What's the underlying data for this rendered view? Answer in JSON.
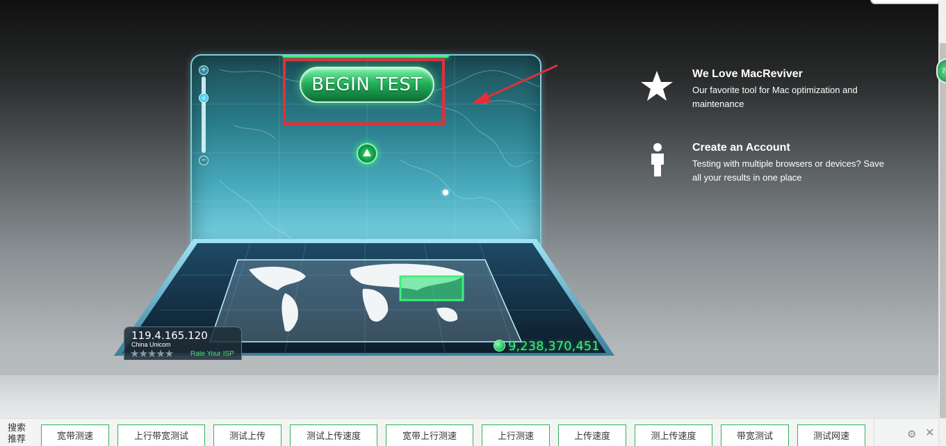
{
  "test": {
    "begin_label": "BEGIN TEST",
    "zoom_in": "+",
    "zoom_out": "−"
  },
  "connection": {
    "ip": "119.4.165.120",
    "isp": "China Unicom",
    "stars": "★★★★★",
    "rate_label": "Rate Your ISP",
    "test_count": "9,238,370,451"
  },
  "promos": [
    {
      "icon": "star-icon",
      "title": "We Love MacReviver",
      "description": "Our favorite tool for Mac optimization and maintenance"
    },
    {
      "icon": "person-icon",
      "title": "Create an Account",
      "description": "Testing with multiple browsers or devices? Save all your results in one place"
    }
  ],
  "search_bar": {
    "label": "搜索推荐",
    "chips": [
      "宽带测速",
      "上行带宽测试",
      "测试上传",
      "测试上传速度",
      "宽带上行测速",
      "上行测速",
      "上传速度",
      "测上传速度",
      "带宽测试",
      "测试网速"
    ]
  },
  "side_badge": "7",
  "colors": {
    "accent_green": "#2fb25c",
    "highlight_red": "#e0303a",
    "screen_cyan": "#4aaec0"
  }
}
